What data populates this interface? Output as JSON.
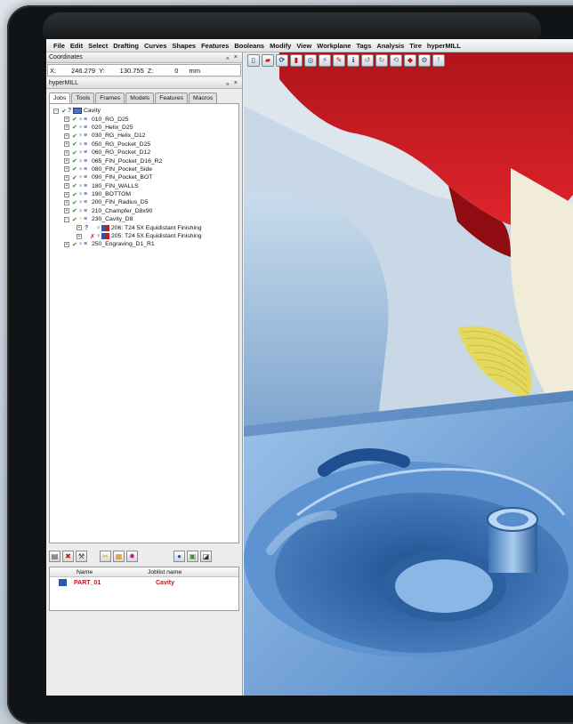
{
  "menu": [
    "File",
    "Edit",
    "Select",
    "Drafting",
    "Curves",
    "Shapes",
    "Features",
    "Booleans",
    "Modify",
    "View",
    "Workplane",
    "Tags",
    "Analysis",
    "Tire",
    "hyperMILL"
  ],
  "coordinates": {
    "title": "Coordinates",
    "controls": "ₐ ×",
    "x_label": "X:",
    "x_value": "246.279",
    "y_label": "Y:",
    "y_value": "130.755",
    "z_label": "Z:",
    "z_value": "0",
    "unit": "mm"
  },
  "hypermill": {
    "title": "hyperMILL",
    "controls": "ₐ ×",
    "tabs": [
      "Jobs",
      "Tools",
      "Frames",
      "Models",
      "Features",
      "Macros"
    ],
    "active_tab": "Jobs",
    "root": "Cavity",
    "jobs": [
      {
        "label": "010_RG_D25"
      },
      {
        "label": "020_Helix_D25"
      },
      {
        "label": "030_RG_Helix_D12"
      },
      {
        "label": "050_RG_Pocket_D25"
      },
      {
        "label": "060_RG_Pocket_D12"
      },
      {
        "label": "065_FIN_Pocket_D16_R2"
      },
      {
        "label": "080_FIN_Pocket_Side"
      },
      {
        "label": "090_FIN_Pocket_BOT"
      },
      {
        "label": "180_FIN_WALLS"
      },
      {
        "label": "190_BOTTOM"
      },
      {
        "label": "200_FIN_Radius_D5"
      },
      {
        "label": "210_Champfer_D8x90"
      },
      {
        "label": "230_Cavity_D8"
      },
      {
        "label": "206: T24 5X Equidistant Finishing"
      },
      {
        "label": "205: T24 5X Equidistant Finishing"
      },
      {
        "label": "250_Engraving_D1_R1"
      }
    ],
    "joblist": {
      "col_name": "Name",
      "col_joblist": "Joblist name",
      "row_name": "PART_01",
      "row_joblist": "Cavity"
    }
  },
  "icons": {
    "tree_expand": "plus-box-icon",
    "check": "check-icon",
    "bulb": "bulb-icon",
    "job": "job-icon"
  },
  "colors": {
    "accent_red": "#c0141a",
    "check_green": "#2c8a2a",
    "model_red": "#c8121a",
    "part_blue": "#6f9ed0",
    "toolpath_yellow": "#e8d84a"
  }
}
